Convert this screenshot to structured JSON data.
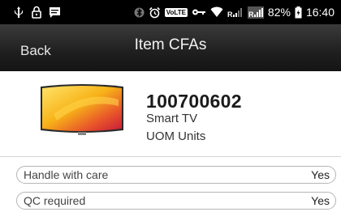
{
  "status_bar": {
    "battery": "82%",
    "time": "16:40",
    "volte": "VoLTE",
    "signal_label": "R"
  },
  "header": {
    "back_label": "Back",
    "title": "Item CFAs"
  },
  "item": {
    "code": "100700602",
    "name": "Smart TV",
    "uom": "UOM Units"
  },
  "attributes": [
    {
      "label": "Handle with care",
      "value": "Yes"
    },
    {
      "label": "QC required",
      "value": "Yes"
    }
  ]
}
